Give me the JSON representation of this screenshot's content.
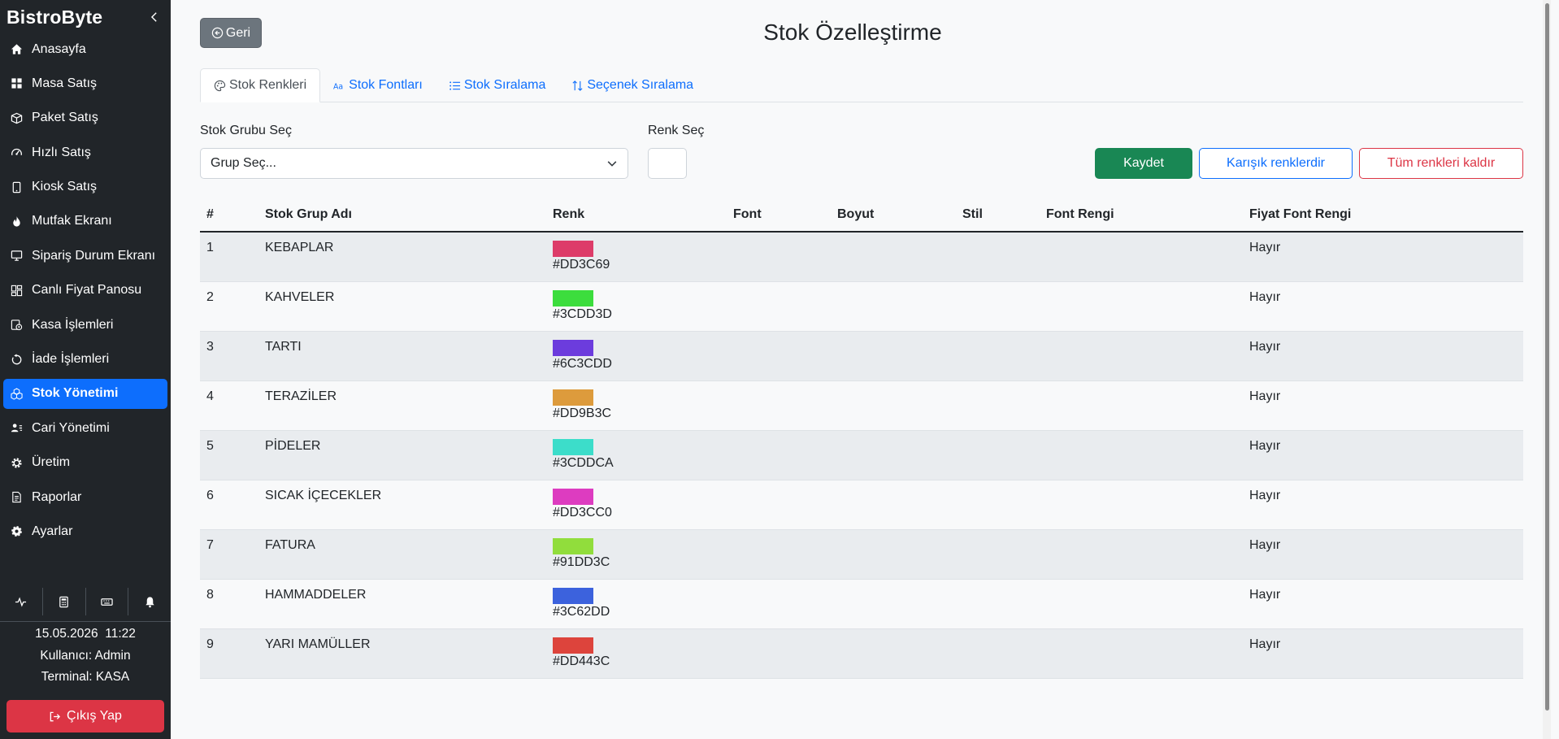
{
  "sidebar": {
    "brand": "BistroByte",
    "items": [
      {
        "label": "Anasayfa",
        "icon": "home-icon"
      },
      {
        "label": "Masa Satış",
        "icon": "grid-icon"
      },
      {
        "label": "Paket Satış",
        "icon": "box-icon"
      },
      {
        "label": "Hızlı Satış",
        "icon": "speedometer-icon"
      },
      {
        "label": "Kiosk Satış",
        "icon": "tablet-icon"
      },
      {
        "label": "Mutfak Ekranı",
        "icon": "fire-icon"
      },
      {
        "label": "Sipariş Durum Ekranı",
        "icon": "monitor-icon"
      },
      {
        "label": "Canlı Fiyat Panosu",
        "icon": "dashboard-icon"
      },
      {
        "label": "Kasa İşlemleri",
        "icon": "cash-register-icon"
      },
      {
        "label": "İade İşlemleri",
        "icon": "undo-icon"
      },
      {
        "label": "Stok Yönetimi",
        "icon": "boxes-icon",
        "active": true
      },
      {
        "label": "Cari Yönetimi",
        "icon": "person-lines-icon"
      },
      {
        "label": "Üretim",
        "icon": "gear-icon"
      },
      {
        "label": "Raporlar",
        "icon": "file-text-icon"
      },
      {
        "label": "Ayarlar",
        "icon": "settings-icon"
      }
    ],
    "datetime": "15.05.2026  11:22",
    "user": "Kullanıcı: Admin",
    "terminal": "Terminal: KASA",
    "logout": "Çıkış Yap"
  },
  "header": {
    "back": "Geri",
    "title": "Stok Özelleştirme"
  },
  "tabs": [
    {
      "label": "Stok Renkleri",
      "active": true
    },
    {
      "label": "Stok Fontları"
    },
    {
      "label": "Stok Sıralama"
    },
    {
      "label": "Seçenek Sıralama"
    }
  ],
  "form": {
    "group_label": "Stok Grubu Seç",
    "group_value": "Grup Seç...",
    "color_label": "Renk Seç",
    "save": "Kaydet",
    "mix": "Karışık renklerdir",
    "clear": "Tüm renkleri kaldır"
  },
  "table": {
    "headers": [
      "#",
      "Stok Grup Adı",
      "Renk",
      "Font",
      "Boyut",
      "Stil",
      "Font Rengi",
      "Fiyat Font Rengi"
    ],
    "rows": [
      {
        "no": "1",
        "name": "KEBAPLAR",
        "color": "#DD3C69",
        "price_font_color": "Hayır"
      },
      {
        "no": "2",
        "name": "KAHVELER",
        "color": "#3CDD3D",
        "price_font_color": "Hayır"
      },
      {
        "no": "3",
        "name": "TARTI",
        "color": "#6C3CDD",
        "price_font_color": "Hayır"
      },
      {
        "no": "4",
        "name": "TERAZİLER",
        "color": "#DD9B3C",
        "price_font_color": "Hayır"
      },
      {
        "no": "5",
        "name": "PİDELER",
        "color": "#3CDDCA",
        "price_font_color": "Hayır"
      },
      {
        "no": "6",
        "name": "SICAK İÇECEKLER",
        "color": "#DD3CC0",
        "price_font_color": "Hayır"
      },
      {
        "no": "7",
        "name": "FATURA",
        "color": "#91DD3C",
        "price_font_color": "Hayır"
      },
      {
        "no": "8",
        "name": "HAMMADDELER",
        "color": "#3C62DD",
        "price_font_color": "Hayır"
      },
      {
        "no": "9",
        "name": "YARI MAMÜLLER",
        "color": "#DD443C",
        "price_font_color": "Hayır"
      }
    ]
  },
  "colors": {
    "sidebar_bg": "#212529",
    "active": "#0d6efd",
    "save": "#198754",
    "danger": "#dc3545"
  }
}
